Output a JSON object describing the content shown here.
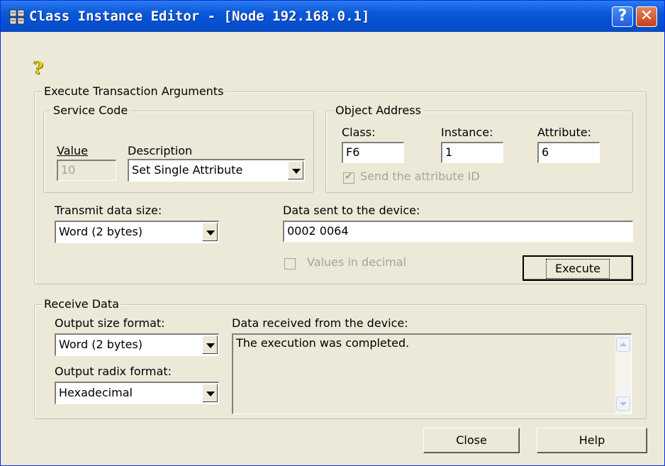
{
  "window": {
    "title": "Class Instance Editor - [Node 192.168.0.1]",
    "title_icon": "app-icon",
    "help_glyph": "?",
    "close_glyph": "✕",
    "accent": "#0a58d8"
  },
  "help_icon_glyph": "?",
  "execute_group": {
    "legend": "Execute Transaction Arguments",
    "service_code": {
      "legend": "Service Code",
      "value_label": "Value",
      "value": "10",
      "description_label": "Description",
      "description_value": "Set Single Attribute"
    },
    "object_address": {
      "legend": "Object Address",
      "class_label": "Class:",
      "class_value": "F6",
      "instance_label": "Instance:",
      "instance_value": "1",
      "attribute_label": "Attribute:",
      "attribute_value": "6",
      "send_attr_id_label": "Send the attribute ID",
      "send_attr_id_checked": true
    },
    "transmit_size_label": "Transmit data size:",
    "transmit_size_value": "Word (2 bytes)",
    "data_sent_label": "Data sent to the device:",
    "data_sent_value": "0002 0064",
    "values_decimal_label": "Values in decimal",
    "execute_label": "Execute"
  },
  "receive_group": {
    "legend": "Receive Data",
    "output_size_label": "Output size format:",
    "output_size_value": "Word (2 bytes)",
    "output_radix_label": "Output radix format:",
    "output_radix_value": "Hexadecimal",
    "data_received_label": "Data received from the device:",
    "data_received_value": "The execution was completed."
  },
  "buttons": {
    "close": "Close",
    "help": "Help"
  }
}
